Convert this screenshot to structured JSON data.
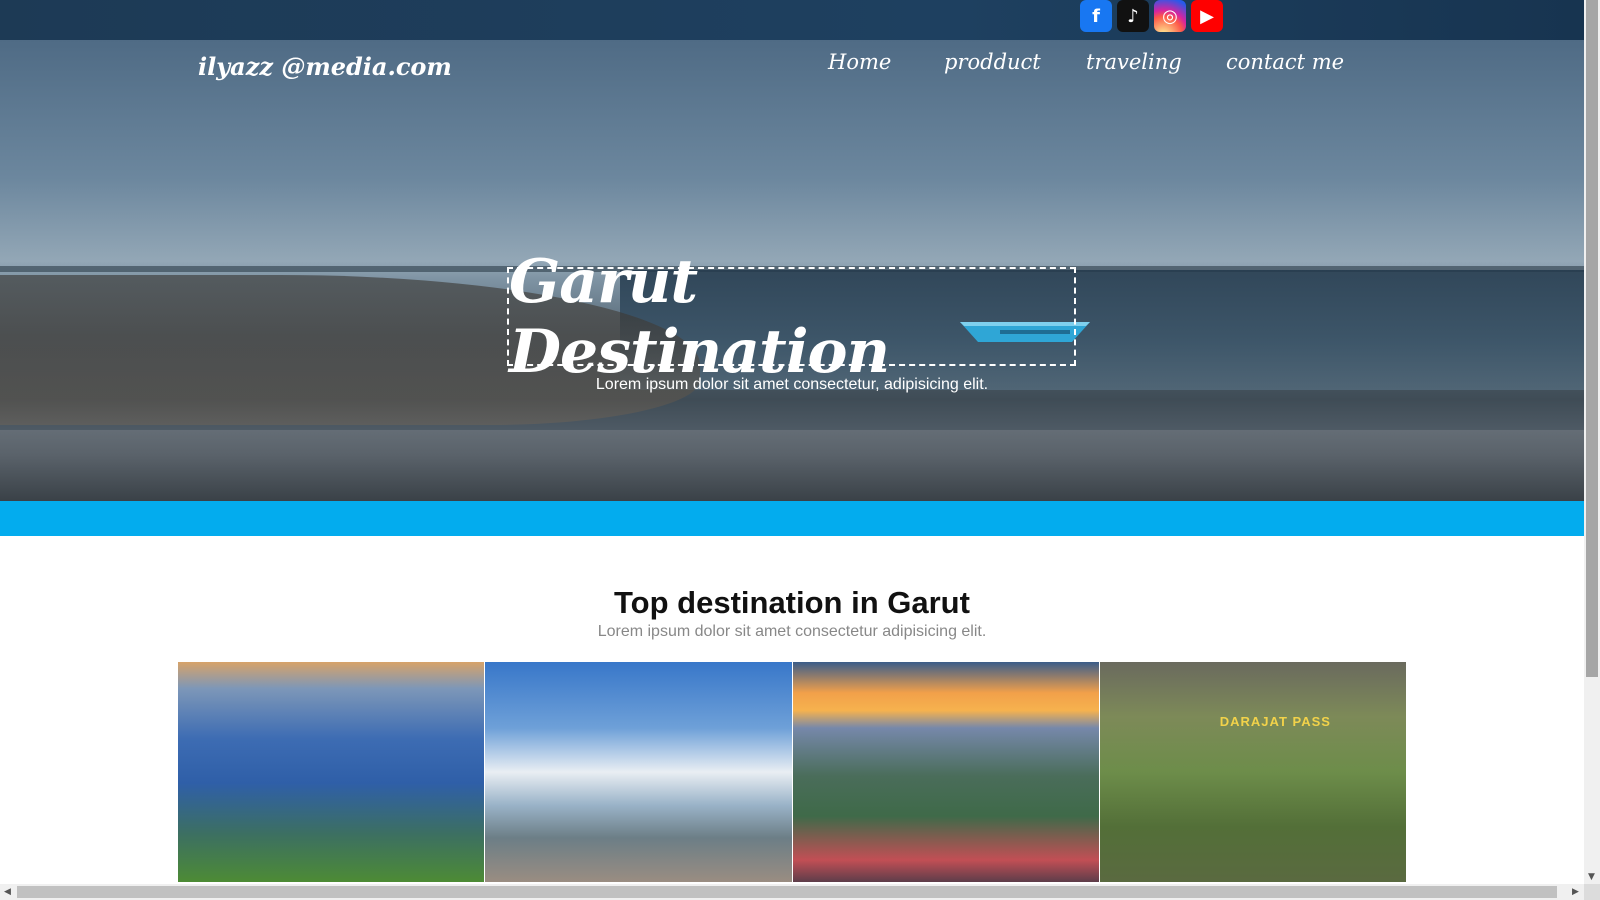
{
  "header": {
    "brand": "ilyazz @media.com",
    "nav": [
      "Home",
      "prodduct",
      "traveling",
      "contact me"
    ]
  },
  "socials": [
    {
      "name": "facebook-icon",
      "glyph": "f"
    },
    {
      "name": "tiktok-icon",
      "glyph": "♪"
    },
    {
      "name": "instagram-icon",
      "glyph": "◎"
    },
    {
      "name": "youtube-icon",
      "glyph": "▶"
    }
  ],
  "hero": {
    "title": "Garut Destination",
    "subtitle": "Lorem ipsum dolor sit amet consectetur, adipisicing elit."
  },
  "section": {
    "title": "Top destination in Garut",
    "subtitle": "Lorem ipsum dolor sit amet consectetur adipisicing elit."
  },
  "gallery": {
    "tile4_sign": "DARAJAT PASS"
  },
  "colors": {
    "accent_band": "#03acee",
    "topbar": "#1d3a55"
  }
}
